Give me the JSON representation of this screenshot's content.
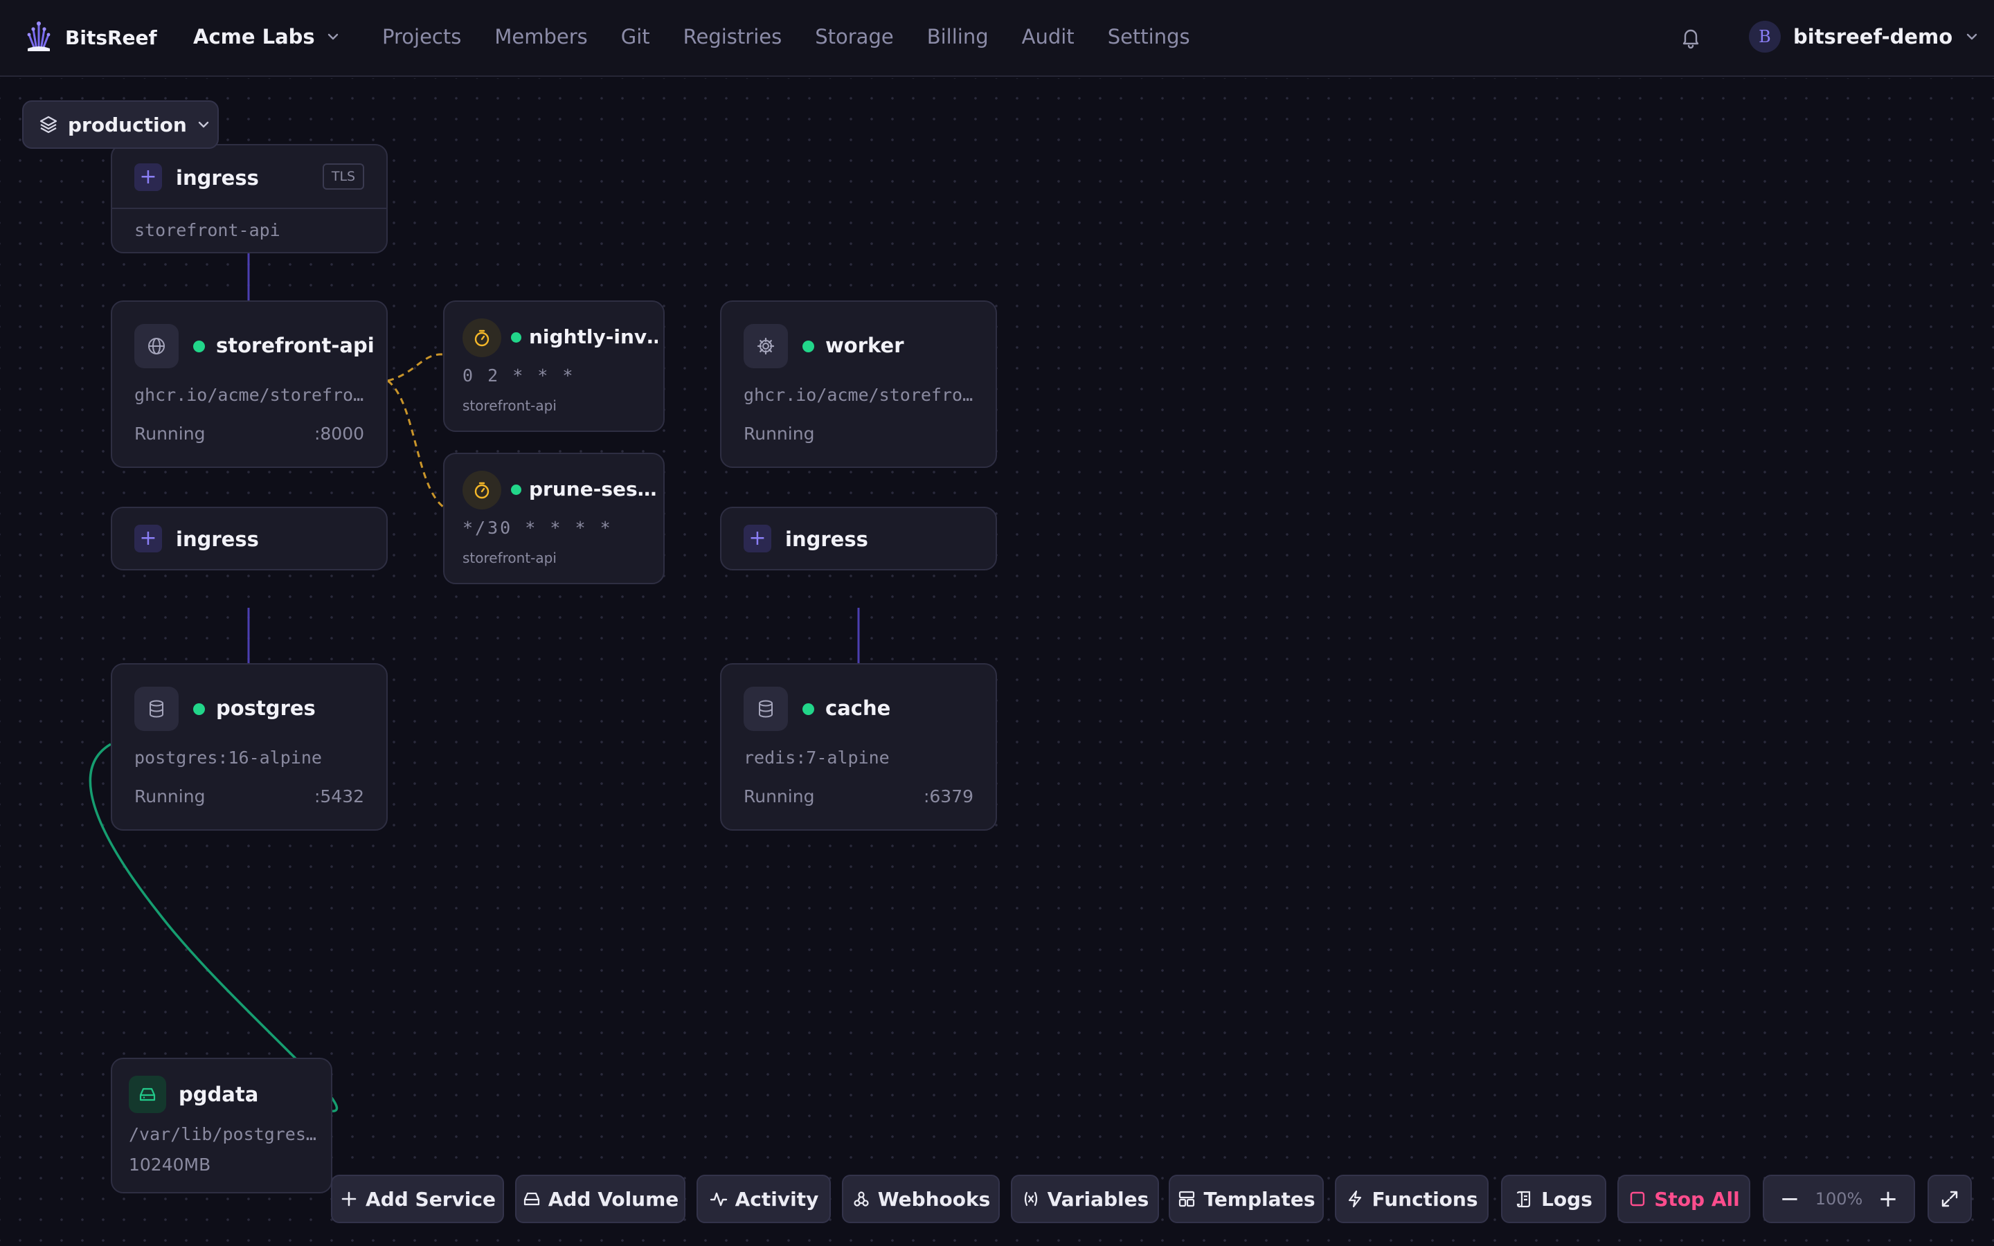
{
  "app": {
    "brand": "BitsReef",
    "org": "Acme Labs",
    "user_initial": "B",
    "user_name": "bitsreef-demo",
    "colors": {
      "accent": "#8b7ff7",
      "running": "#22d68a",
      "cron": "#f5b829",
      "volume": "#22c98a",
      "danger": "#ff4d8d"
    }
  },
  "nav": [
    "Projects",
    "Members",
    "Git",
    "Registries",
    "Storage",
    "Billing",
    "Audit",
    "Settings"
  ],
  "environment": "production",
  "nodes": {
    "ingress_top": {
      "title": "ingress",
      "badge": "TLS",
      "target": "storefront-api"
    },
    "storefront": {
      "title": "storefront-api",
      "image": "ghcr.io/acme/storefro…",
      "status": "Running",
      "port": ":8000",
      "icon": "globe-icon"
    },
    "cron1": {
      "title": "nightly-inv…",
      "schedule": "0 2 * * *",
      "target": "storefront-api",
      "icon": "timer-icon"
    },
    "cron2": {
      "title": "prune-ses…",
      "schedule": "*/30 * * * *",
      "target": "storefront-api",
      "icon": "timer-icon"
    },
    "worker": {
      "title": "worker",
      "image": "ghcr.io/acme/storefro…",
      "status": "Running",
      "icon": "gear-icon"
    },
    "ingress_storefront": {
      "title": "ingress"
    },
    "ingress_worker": {
      "title": "ingress"
    },
    "postgres": {
      "title": "postgres",
      "image": "postgres:16-alpine",
      "status": "Running",
      "port": ":5432",
      "icon": "database-icon"
    },
    "cache": {
      "title": "cache",
      "image": "redis:7-alpine",
      "status": "Running",
      "port": ":6379",
      "icon": "database-icon"
    },
    "pgdata": {
      "title": "pgdata",
      "path": "/var/lib/postgres…",
      "size": "10240MB",
      "icon": "hard-drive-icon"
    }
  },
  "toolbar": {
    "add_service": "Add Service",
    "add_volume": "Add Volume",
    "activity": "Activity",
    "webhooks": "Webhooks",
    "variables": "Variables",
    "templates": "Templates",
    "functions": "Functions",
    "logs": "Logs",
    "stop_all": "Stop All",
    "zoom_out": "−",
    "zoom_level": "100%",
    "zoom_in": "+"
  }
}
